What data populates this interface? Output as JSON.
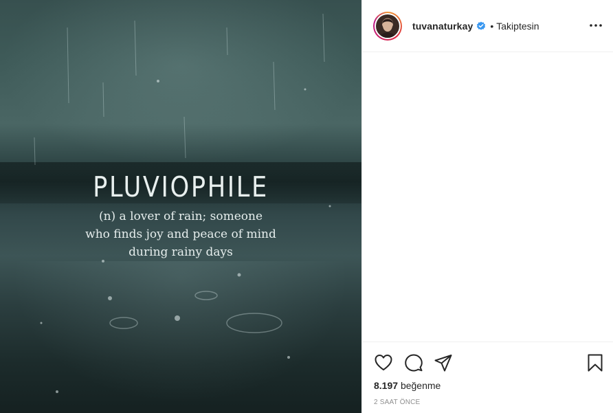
{
  "post": {
    "image": {
      "title": "PLUVIOPHILE",
      "definition": [
        "(n) a lover of rain; someone",
        "who finds joy and peace of mind",
        "during rainy days"
      ]
    },
    "header": {
      "username": "tuvanaturkay",
      "verified_icon": "verified-badge-icon",
      "separator": "•",
      "follow_state": "Takiptesin",
      "more_icon": "more-options-icon"
    },
    "actions": {
      "like_icon": "heart-icon",
      "comment_icon": "comment-icon",
      "share_icon": "paper-plane-icon",
      "save_icon": "bookmark-icon",
      "likes_count": "8.197",
      "likes_word": "beğenme",
      "timestamp": "2 saat önce"
    },
    "colors": {
      "verified_blue": "#3897f0",
      "text": "#262626",
      "muted": "#8e8e8e",
      "divider": "#efefef"
    }
  }
}
